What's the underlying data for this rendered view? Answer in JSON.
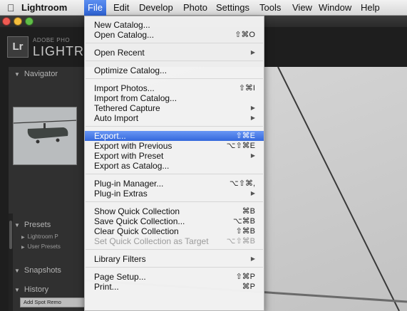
{
  "menubar": {
    "apple_icon": "apple-icon",
    "items": [
      "Lightroom",
      "File",
      "Edit",
      "Develop",
      "Photo",
      "Settings",
      "Tools",
      "View",
      "Window",
      "Help"
    ]
  },
  "app": {
    "adobe_label": "ADOBE PHO",
    "name_label": "LIGHTR",
    "logo_text": "Lr"
  },
  "left_panel": {
    "navigator": "Navigator",
    "presets": "Presets",
    "preset_items": [
      "Lightroom P",
      "User Presets"
    ],
    "snapshots": "Snapshots",
    "history": "History",
    "history_button": "Add Spot Remo"
  },
  "file_menu": {
    "groups": [
      [
        {
          "label": "New Catalog..."
        },
        {
          "label": "Open Catalog...",
          "shortcut": "⇧⌘O"
        }
      ],
      [
        {
          "label": "Open Recent",
          "submenu": true
        }
      ],
      [
        {
          "label": "Optimize Catalog..."
        }
      ],
      [
        {
          "label": "Import Photos...",
          "shortcut": "⇧⌘I"
        },
        {
          "label": "Import from Catalog..."
        },
        {
          "label": "Tethered Capture",
          "submenu": true
        },
        {
          "label": "Auto Import",
          "submenu": true
        }
      ],
      [
        {
          "label": "Export...",
          "shortcut": "⇧⌘E",
          "highlighted": true
        },
        {
          "label": "Export with Previous",
          "shortcut": "⌥⇧⌘E"
        },
        {
          "label": "Export with Preset",
          "submenu": true
        },
        {
          "label": "Export as Catalog..."
        }
      ],
      [
        {
          "label": "Plug-in Manager...",
          "shortcut": "⌥⇧⌘,"
        },
        {
          "label": "Plug-in Extras",
          "submenu": true
        }
      ],
      [
        {
          "label": "Show Quick Collection",
          "shortcut": "⌘B"
        },
        {
          "label": "Save Quick Collection...",
          "shortcut": "⌥⌘B"
        },
        {
          "label": "Clear Quick Collection",
          "shortcut": "⇧⌘B"
        },
        {
          "label": "Set Quick Collection as Target",
          "shortcut": "⌥⇧⌘B",
          "disabled": true
        }
      ],
      [
        {
          "label": "Library Filters",
          "submenu": true
        }
      ],
      [
        {
          "label": "Page Setup...",
          "shortcut": "⇧⌘P"
        },
        {
          "label": "Print...",
          "shortcut": "⌘P"
        }
      ]
    ]
  },
  "colors": {
    "highlight": "#3468dc",
    "traffic_close": "#ee5a52",
    "traffic_min": "#f5be3c",
    "traffic_zoom": "#5fbe47"
  }
}
